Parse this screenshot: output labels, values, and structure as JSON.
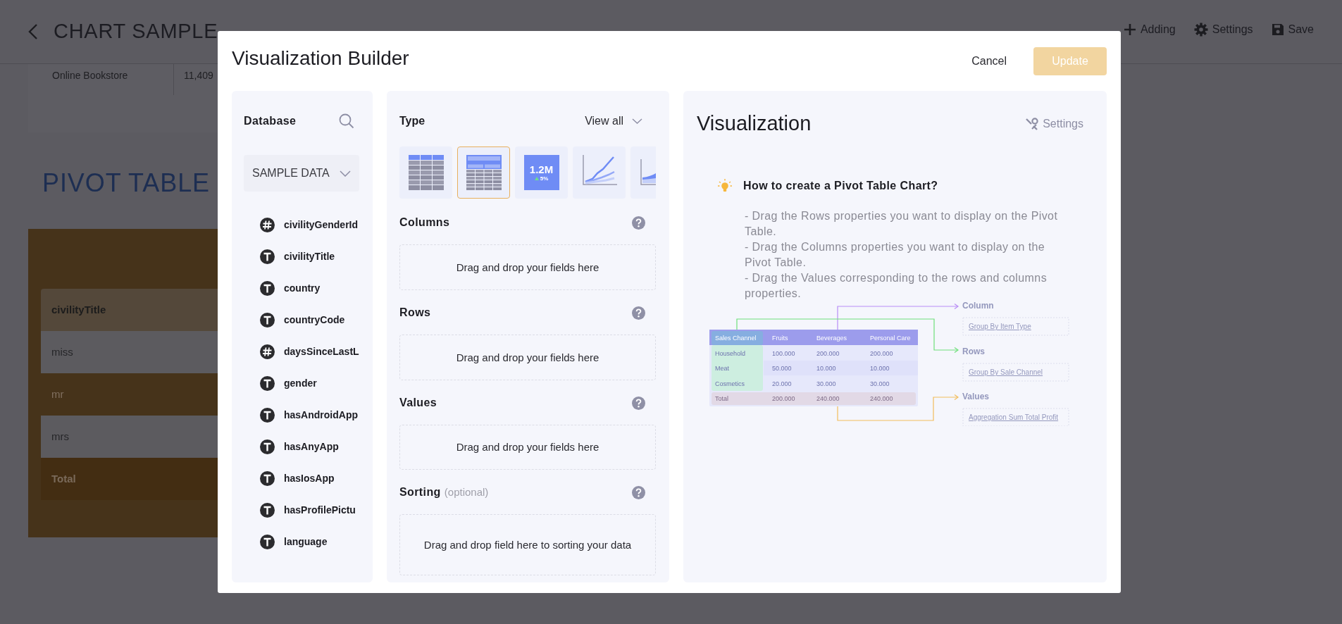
{
  "page": {
    "title": "CHART SAMPLE",
    "toolbar": [
      {
        "kind": "plus",
        "label": "Adding"
      },
      {
        "kind": "gear",
        "label": "Settings"
      },
      {
        "kind": "save",
        "label": "Save"
      }
    ],
    "background_row": [
      "Online Bookstore",
      "11,409"
    ],
    "section_title": "PIVOT TABLE",
    "pivot_rows": [
      {
        "kind": "header",
        "label": "civilityTitle"
      },
      {
        "kind": "light",
        "label": "miss"
      },
      {
        "kind": "dark",
        "label": "mr"
      },
      {
        "kind": "light",
        "label": "mrs"
      },
      {
        "kind": "total",
        "label": "Total"
      }
    ]
  },
  "dialog": {
    "title": "Visualization Builder",
    "cancel": "Cancel",
    "update": {
      "label": "Update",
      "disabled": true
    },
    "database": {
      "title": "Database",
      "dropdown": "SAMPLE DATA",
      "fields": [
        {
          "kind": "number",
          "name": "civilityGenderId"
        },
        {
          "kind": "text",
          "name": "civilityTitle"
        },
        {
          "kind": "text",
          "name": "country"
        },
        {
          "kind": "text",
          "name": "countryCode"
        },
        {
          "kind": "number",
          "name": "daysSinceLastL"
        },
        {
          "kind": "text",
          "name": "gender"
        },
        {
          "kind": "text",
          "name": "hasAndroidApp"
        },
        {
          "kind": "text",
          "name": "hasAnyApp"
        },
        {
          "kind": "text",
          "name": "hasIosApp"
        },
        {
          "kind": "text",
          "name": "hasProfilePictu"
        },
        {
          "kind": "text",
          "name": "language"
        }
      ]
    },
    "type_section": {
      "title": "Type",
      "view_all": "View all",
      "types": [
        {
          "kind": "table",
          "selected": false
        },
        {
          "kind": "pivot",
          "selected": true
        },
        {
          "kind": "kpi",
          "selected": false,
          "value": "1.2M",
          "delta": "5%"
        },
        {
          "kind": "line",
          "selected": false
        },
        {
          "kind": "area",
          "selected": false
        }
      ]
    },
    "zones": [
      {
        "title": "Columns",
        "placeholder": "Drag and drop your fields here"
      },
      {
        "title": "Rows",
        "placeholder": "Drag and drop your fields here"
      },
      {
        "title": "Values",
        "placeholder": "Drag and drop your fields here"
      },
      {
        "title": "Sorting",
        "note": "(optional)",
        "placeholder": "Drag and drop field here to sorting your data"
      }
    ],
    "visualization": {
      "title": "Visualization",
      "settings": "Settings",
      "help_title": "How to create a Pivot Table Chart?",
      "steps": [
        "- Drag the Rows properties you want to display on the Pivot Table.",
        "- Drag the Columns properties you want to display on the Pivot Table.",
        "- Drag the Values corresponding to the rows and columns properties."
      ],
      "illustration": {
        "header": [
          "Sales Channel",
          "Fruits",
          "Beverages",
          "Personal Care"
        ],
        "rows": [
          [
            "Household",
            "100.000",
            "200.000",
            "200.000"
          ],
          [
            "Meat",
            "50.000",
            "10.000",
            "10.000"
          ],
          [
            "Cosmetics",
            "20.000",
            "30.000",
            "30.000"
          ]
        ],
        "total": [
          "Total",
          "200.000",
          "240.000",
          "240.000"
        ],
        "labels": [
          {
            "title": "Column",
            "value": "Group By Item Type"
          },
          {
            "title": "Rows",
            "value": "Group By Sale Channel"
          },
          {
            "title": "Values",
            "value": "Aggregation Sum Total Profit"
          }
        ]
      }
    }
  }
}
